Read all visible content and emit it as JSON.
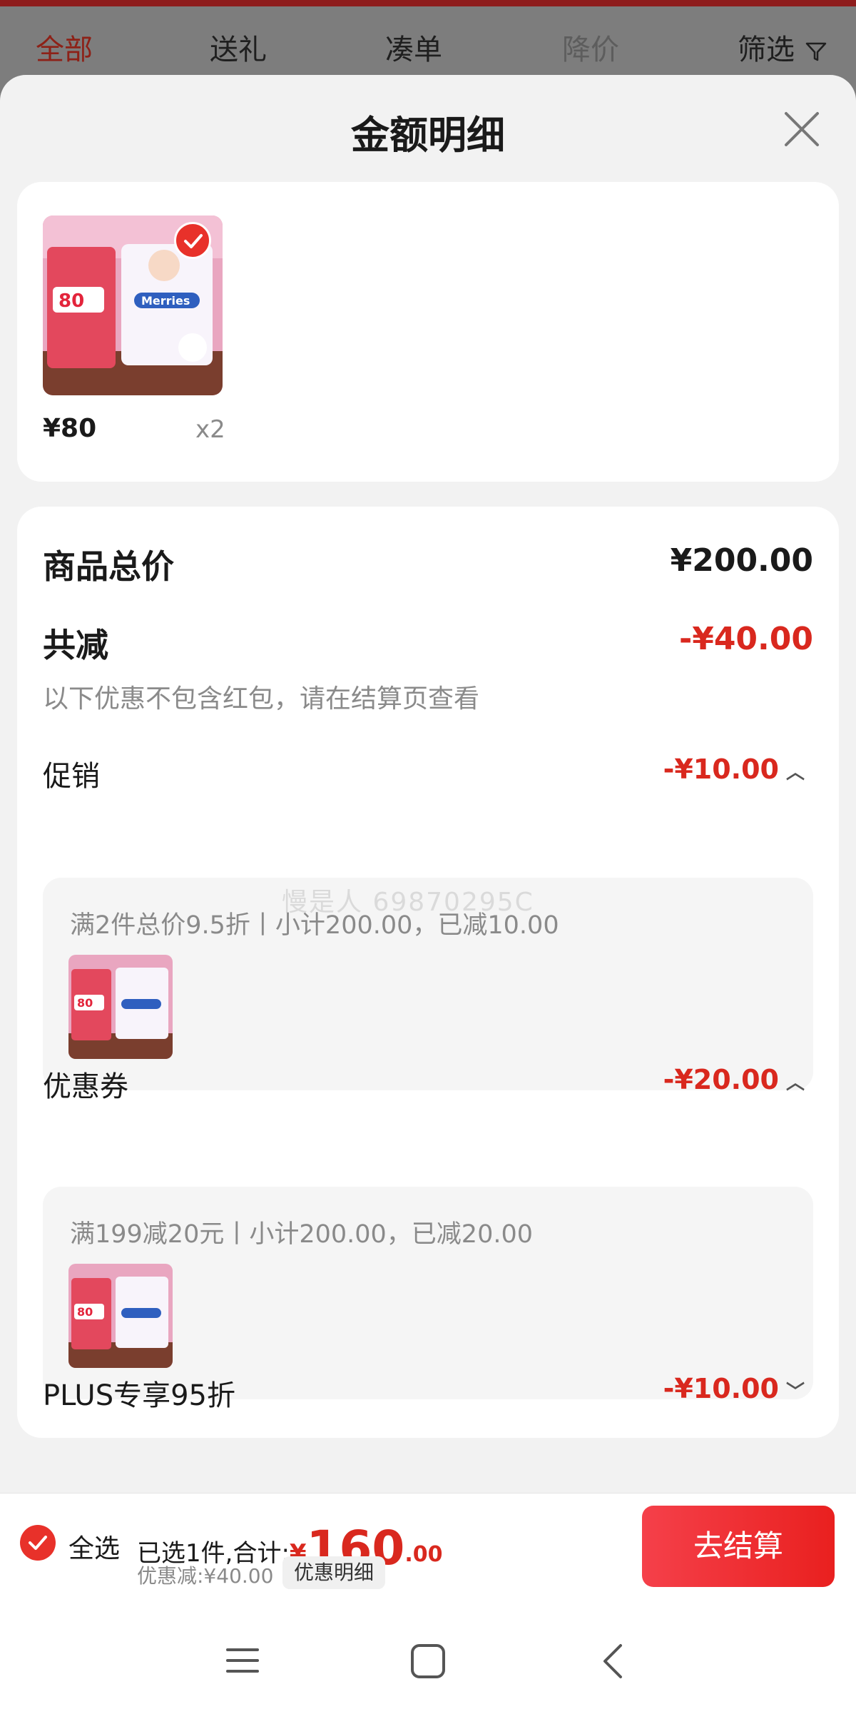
{
  "tabs": [
    {
      "label": "全部",
      "active": true
    },
    {
      "label": "送礼"
    },
    {
      "label": "凑单"
    },
    {
      "label": "降价"
    },
    {
      "label": "筛选"
    }
  ],
  "sheet": {
    "title": "金额明细",
    "product": {
      "price": "¥80",
      "qty": "x2"
    },
    "total_label": "商品总价",
    "total_value": "¥200.00",
    "reduce_label": "共减",
    "reduce_value": "-¥40.00",
    "note": "以下优惠不包含红包，请在结算页查看",
    "sections": [
      {
        "label": "促销",
        "value": "-¥10.00",
        "detail": "满2件总价9.5折丨小计200.00，已减10.00"
      },
      {
        "label": "优惠券",
        "value": "-¥20.00",
        "detail": "满199减20元丨小计200.00，已减20.00"
      },
      {
        "label": "PLUS专享95折",
        "value": "-¥10.00"
      }
    ],
    "watermark": "慢是人 69870295C"
  },
  "bottom": {
    "select_all": "全选",
    "summary_prefix": "已选1件,合计:",
    "currency": "¥",
    "amount_int": "160",
    "amount_dec": ".00",
    "discount": "优惠减:¥40.00",
    "detail_button": "优惠明细",
    "checkout": "去结算"
  },
  "colors": {
    "accent": "#e8312a",
    "price_red": "#d9281e"
  }
}
